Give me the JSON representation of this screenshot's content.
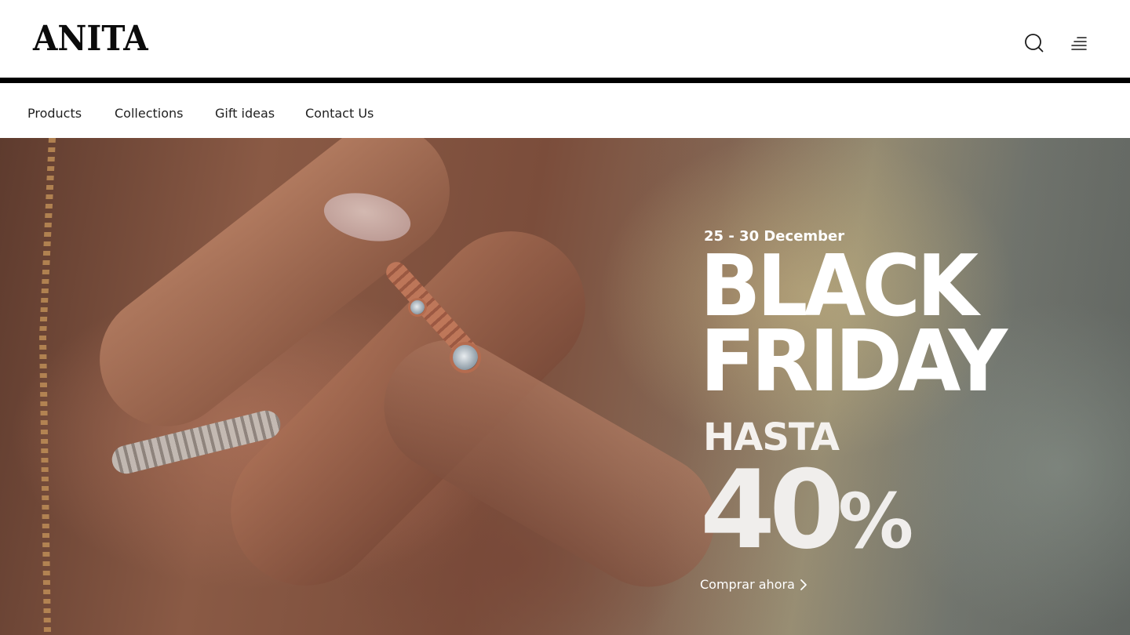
{
  "brand": {
    "logo_text": "ANITA"
  },
  "header": {
    "icons": {
      "search": "search-icon",
      "menu": "menu-icon"
    }
  },
  "nav": {
    "items": [
      {
        "label": "Products"
      },
      {
        "label": "Collections"
      },
      {
        "label": "Gift ideas"
      },
      {
        "label": "Contact Us"
      }
    ]
  },
  "hero": {
    "date_range": "25 - 30 December",
    "headline_line1": "BLACK",
    "headline_line2": "FRIDAY",
    "discount_prefix": "HASTA",
    "discount_value": "40",
    "discount_unit": "%",
    "cta_label": "Comprar ahora",
    "cta_icon": "chevron-right-icon"
  },
  "colors": {
    "header_bg": "#ffffff",
    "rule": "#000000",
    "text_dark": "#1f1f1f",
    "promo_text": "#ffffff"
  }
}
